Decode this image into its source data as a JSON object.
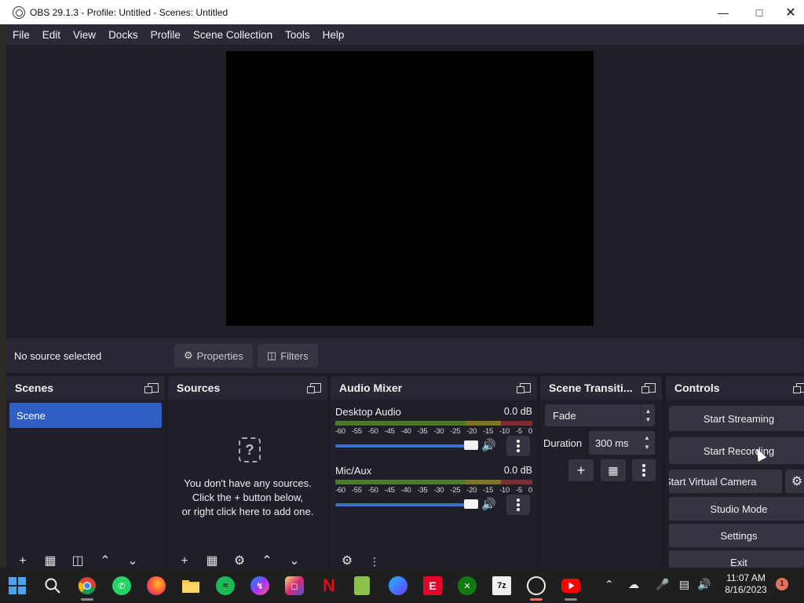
{
  "window": {
    "title": "OBS 29.1.3 - Profile: Untitled - Scenes: Untitled"
  },
  "menu": [
    "File",
    "Edit",
    "View",
    "Docks",
    "Profile",
    "Scene Collection",
    "Tools",
    "Help"
  ],
  "source_bar": {
    "status": "No source selected",
    "properties": "Properties",
    "filters": "Filters"
  },
  "docks": {
    "scenes": {
      "title": "Scenes",
      "items": [
        "Scene"
      ]
    },
    "sources": {
      "title": "Sources",
      "empty_line1": "You don't have any sources.",
      "empty_line2": "Click the + button below,",
      "empty_line3": "or right click here to add one."
    },
    "mixer": {
      "title": "Audio Mixer",
      "ticks": [
        "-60",
        "-55",
        "-50",
        "-45",
        "-40",
        "-35",
        "-30",
        "-25",
        "-20",
        "-15",
        "-10",
        "-5",
        "0"
      ],
      "channels": [
        {
          "name": "Desktop Audio",
          "db": "0.0 dB",
          "volume": 1.0
        },
        {
          "name": "Mic/Aux",
          "db": "0.0 dB",
          "volume": 1.0
        }
      ]
    },
    "transitions": {
      "title": "Scene Transiti...",
      "type": "Fade",
      "duration_label": "Duration",
      "duration": "300 ms"
    },
    "controls": {
      "title": "Controls",
      "start_streaming": "Start Streaming",
      "start_recording": "Start Recording",
      "start_virtual_camera": "Start Virtual Camera",
      "studio_mode": "Studio Mode",
      "settings": "Settings",
      "exit": "Exit"
    }
  },
  "taskbar": {
    "time": "11:07 AM",
    "date": "8/16/2023",
    "notification_count": "1",
    "app_7zip": "7z"
  }
}
